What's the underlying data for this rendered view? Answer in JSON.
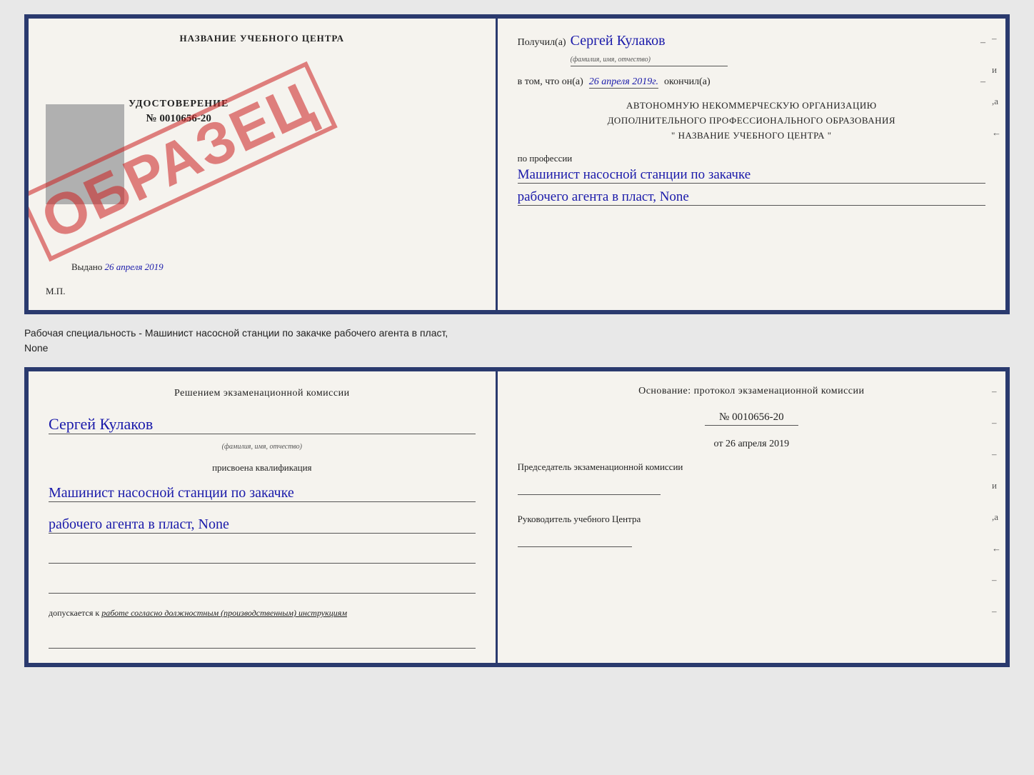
{
  "top_document": {
    "left": {
      "title": "НАЗВАНИЕ УЧЕБНОГО ЦЕНТРА",
      "stamp": "ОБРАЗЕЦ",
      "udostoverenie_label": "УДОСТОВЕРЕНИЕ",
      "number": "№ 0010656-20",
      "vydano_label": "Выдано",
      "vydano_date": "26 апреля 2019",
      "mp_label": "М.П."
    },
    "right": {
      "poluchil_label": "Получил(а)",
      "poluchil_name": "Сергей Кулаков",
      "poluchil_sub": "(фамилия, имя, отчество)",
      "dash1": "–",
      "vtom_label": "в том, что он(а)",
      "vtom_date": "26 апреля 2019г.",
      "okonchil_label": "окончил(а)",
      "dash2": "–",
      "org_line1": "АВТОНОМНУЮ НЕКОММЕРЧЕСКУЮ ОРГАНИЗАЦИЮ",
      "org_line2": "ДОПОЛНИТЕЛЬНОГО ПРОФЕССИОНАЛЬНОГО ОБРАЗОВАНИЯ",
      "org_name": "\" НАЗВАНИЕ УЧЕБНОГО ЦЕНТРА \"",
      "dash3": "–",
      "dash4": "и",
      "dash5": ",а",
      "professia_label": "по профессии",
      "professia_line1": "Машинист насосной станции по закачке",
      "professia_line2": "рабочего агента в пласт, None",
      "dash6": "–",
      "dash7": "–",
      "dash8": "–"
    }
  },
  "caption": {
    "text": "Рабочая специальность - Машинист насосной станции по закачке рабочего агента в пласт,",
    "text2": "None"
  },
  "bottom_document": {
    "left": {
      "resheniem_label": "Решением экзаменационной комиссии",
      "fio": "Сергей Кулаков",
      "fio_sub": "(фамилия, имя, отчество)",
      "prisvoena_label": "присвоена квалификация",
      "kvalif_line1": "Машинист насосной станции по закачке",
      "kvalif_line2": "рабочего агента в пласт, None",
      "dopuskaetsya_label": "допускается к",
      "dopuskaetsya_italic": "работе согласно должностным (производственным) инструкциям"
    },
    "right": {
      "osnovanie_label": "Основание: протокол экзаменационной комиссии",
      "number": "№  0010656-20",
      "ot_label": "от",
      "ot_date": "26 апреля 2019",
      "predsedatel_label": "Председатель экзаменационной комиссии",
      "rukovoditel_label": "Руководитель учебного Центра",
      "dash1": "–",
      "dash2": "–",
      "dash3": "–",
      "dash4": "и",
      "dash5": ",а",
      "dash6": "←",
      "dash7": "–",
      "dash8": "–",
      "dash9": "–",
      "dash10": "–"
    }
  }
}
